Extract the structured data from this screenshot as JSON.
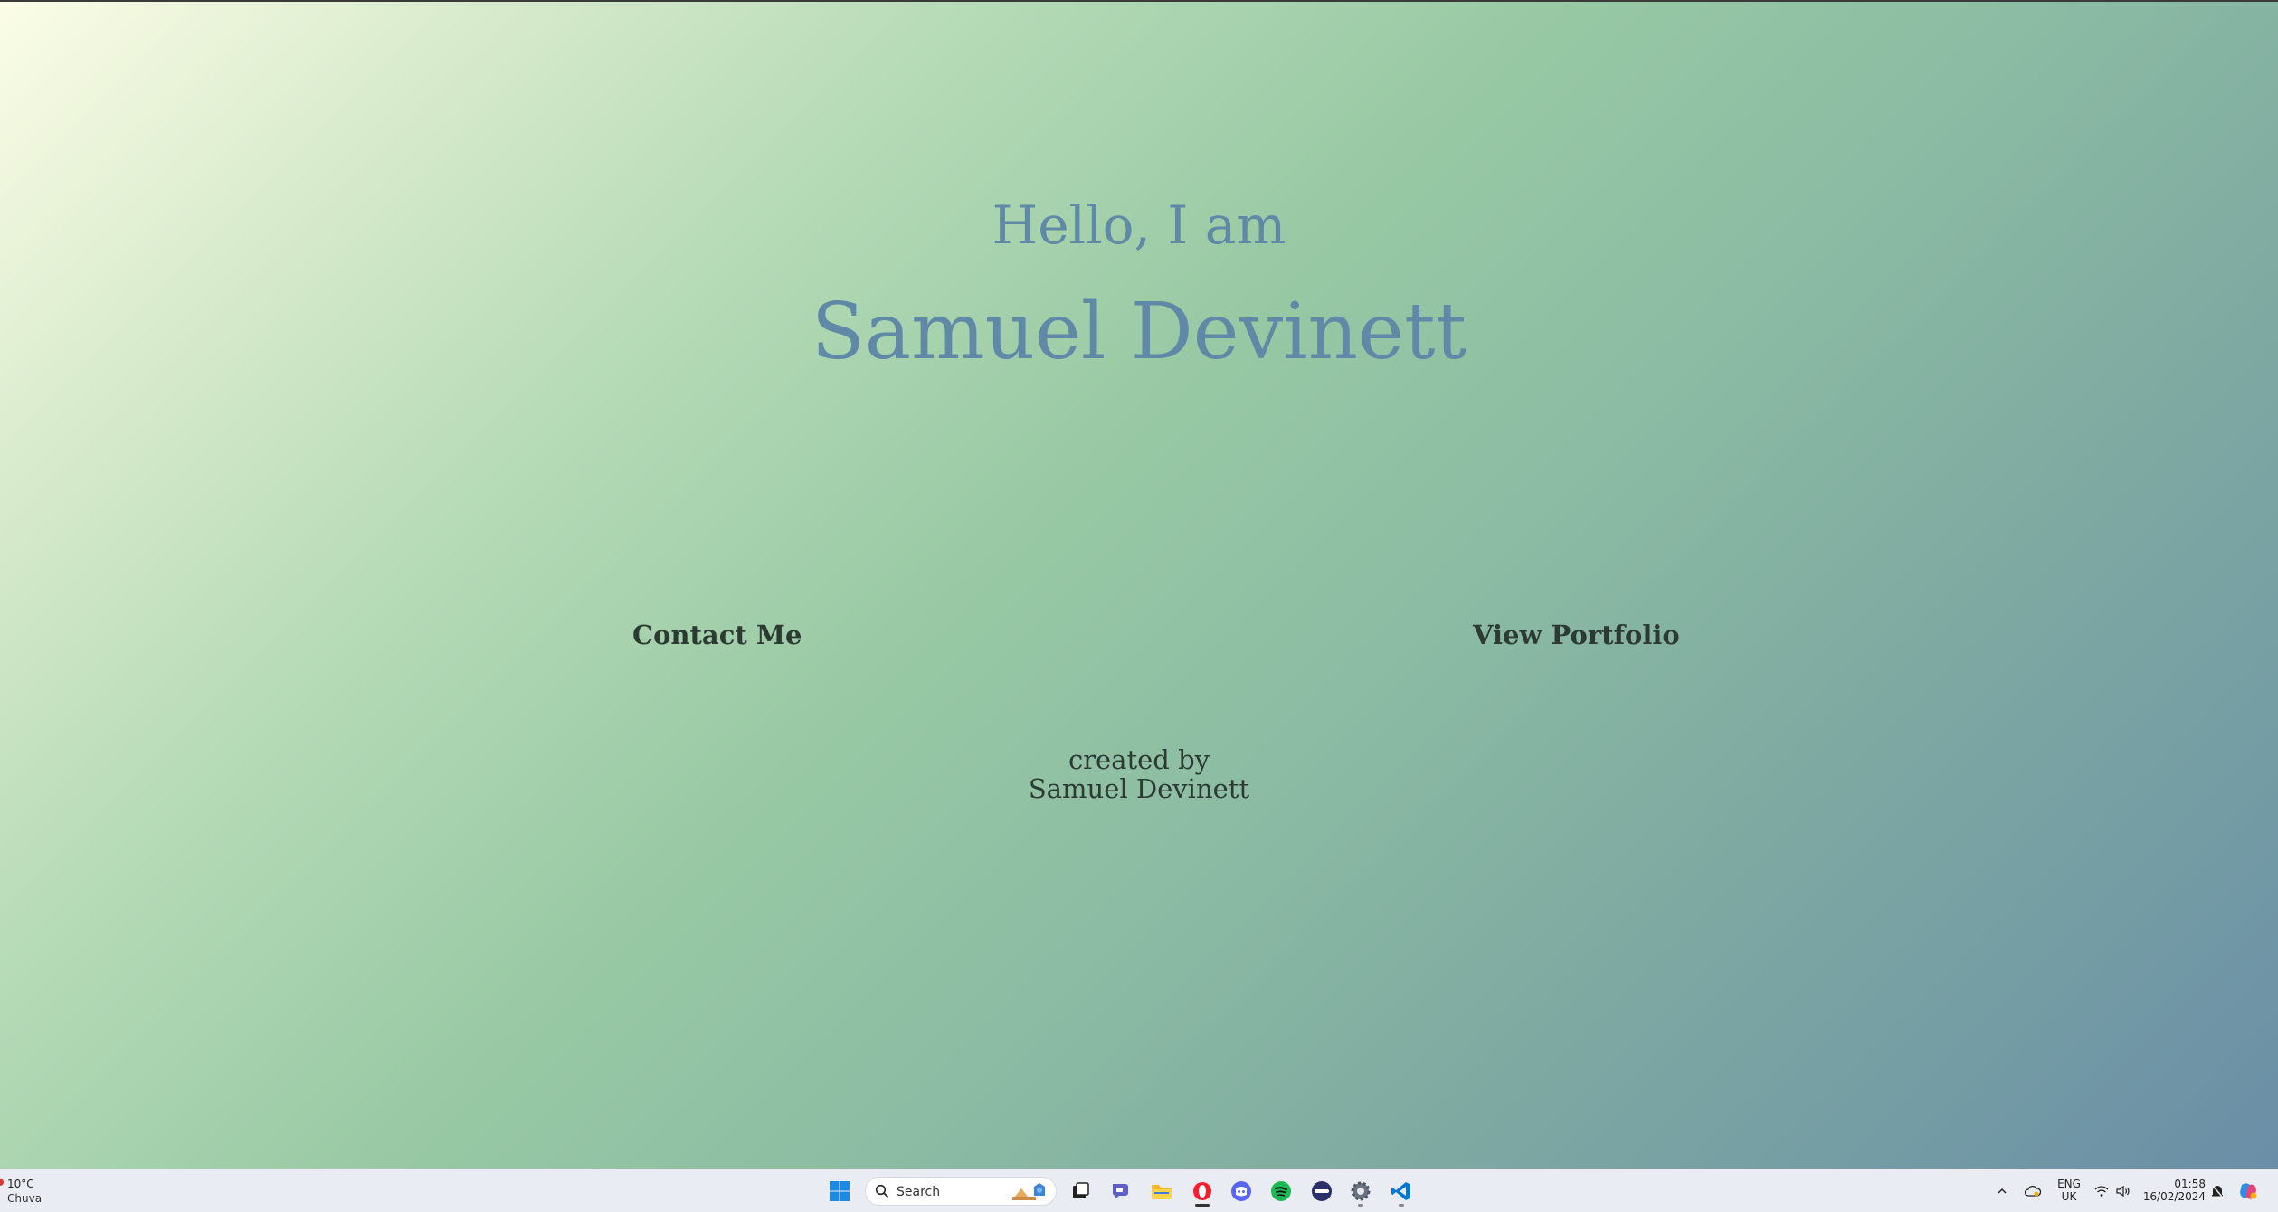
{
  "hero": {
    "greeting": "Hello, I am",
    "name": "Samuel Devinett"
  },
  "links": {
    "contact": "Contact Me",
    "portfolio": "View Portfolio"
  },
  "footer": {
    "line1": "created by",
    "line2": "Samuel Devinett"
  },
  "taskbar": {
    "weather_temp": "10°C",
    "weather_condition": "Chuva",
    "search_label": "Search",
    "apps": [
      "start-icon",
      "task-view-icon",
      "teams-chat-icon",
      "file-explorer-icon",
      "opera-icon",
      "discord-icon",
      "spotify-icon",
      "app-icon",
      "settings-icon",
      "vscode-icon"
    ],
    "language": "ENG",
    "region": "UK",
    "time": "01:58",
    "date": "16/02/2024"
  },
  "colors": {
    "heading": "#6088a7",
    "text": "#2c3a33"
  }
}
